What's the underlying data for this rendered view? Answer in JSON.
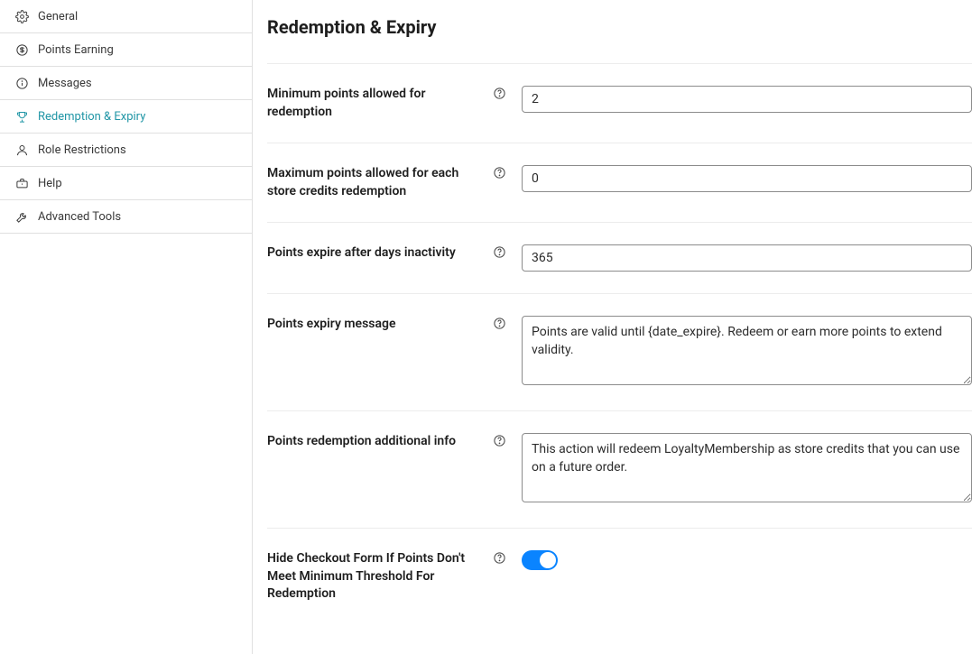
{
  "sidebar": {
    "items": [
      {
        "label": "General"
      },
      {
        "label": "Points Earning"
      },
      {
        "label": "Messages"
      },
      {
        "label": "Redemption & Expiry"
      },
      {
        "label": "Role Restrictions"
      },
      {
        "label": "Help"
      },
      {
        "label": "Advanced Tools"
      }
    ]
  },
  "page": {
    "title": "Redemption & Expiry"
  },
  "form": {
    "min_points": {
      "label": "Minimum points allowed for redemption",
      "value": "2"
    },
    "max_points": {
      "label": "Maximum points allowed for each store credits redemption",
      "value": "0"
    },
    "expire_days": {
      "label": "Points expire after days inactivity",
      "value": "365"
    },
    "expiry_msg": {
      "label": "Points expiry message",
      "value": "Points are valid until {date_expire}. Redeem or earn more points to extend validity."
    },
    "redeem_info": {
      "label": "Points redemption additional info",
      "value": "This action will redeem LoyaltyMembership as store credits that you can use on a future order."
    },
    "hide_checkout": {
      "label": "Hide Checkout Form If Points Don't Meet Minimum Threshold For Redemption",
      "value": true
    }
  }
}
